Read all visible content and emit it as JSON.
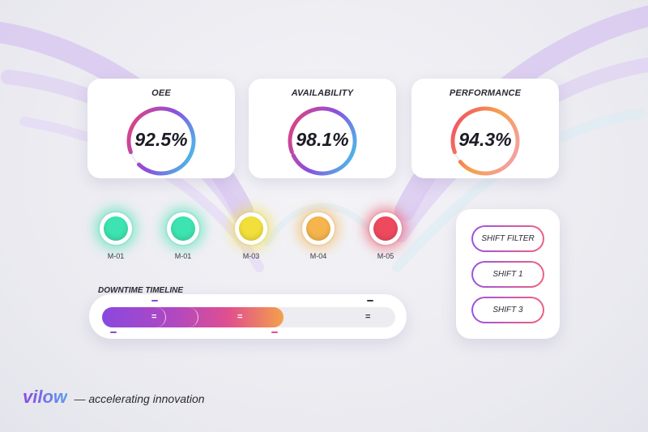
{
  "kpis": [
    {
      "title": "OEE",
      "value": "92.5%",
      "fraction": 0.925,
      "gradient": [
        "#3ad6e8",
        "#8a4fe0",
        "#f0406a"
      ]
    },
    {
      "title": "AVAILABILITY",
      "value": "98.1%",
      "fraction": 0.981,
      "gradient": [
        "#3ad6e8",
        "#8a4fe0",
        "#f0406a"
      ]
    },
    {
      "title": "PERFORMANCE",
      "value": "94.3%",
      "fraction": 0.943,
      "gradient": [
        "#f2a0c0",
        "#f7a04a",
        "#f0406a"
      ]
    }
  ],
  "machines": [
    {
      "label": "M-01",
      "color": "#3de3b0",
      "glow": "rgba(61,227,176,0.55)"
    },
    {
      "label": "M-01",
      "color": "#3de3b0",
      "glow": "rgba(61,227,176,0.55)"
    },
    {
      "label": "M-03",
      "color": "#f2df3c",
      "glow": "rgba(242,223,60,0.55)"
    },
    {
      "label": "M-04",
      "color": "#f6b44c",
      "glow": "rgba(246,180,76,0.55)"
    },
    {
      "label": "M-05",
      "color": "#ee4a5e",
      "glow": "rgba(238,74,94,0.55)"
    }
  ],
  "timeline": {
    "title": "DOWNTIME TIMELINE",
    "fill_fraction": 0.62,
    "handle_glyph": "="
  },
  "shifts": {
    "buttons": [
      "SHIFT FILTER",
      "SHIFT 1",
      "SHIFT 3"
    ]
  },
  "brand": {
    "logo": "vilow",
    "tagline": "— accelerating innovation"
  },
  "colors": {
    "accent_purple": "#8a48de",
    "accent_pink": "#e0508e",
    "accent_orange": "#f4a04a"
  }
}
